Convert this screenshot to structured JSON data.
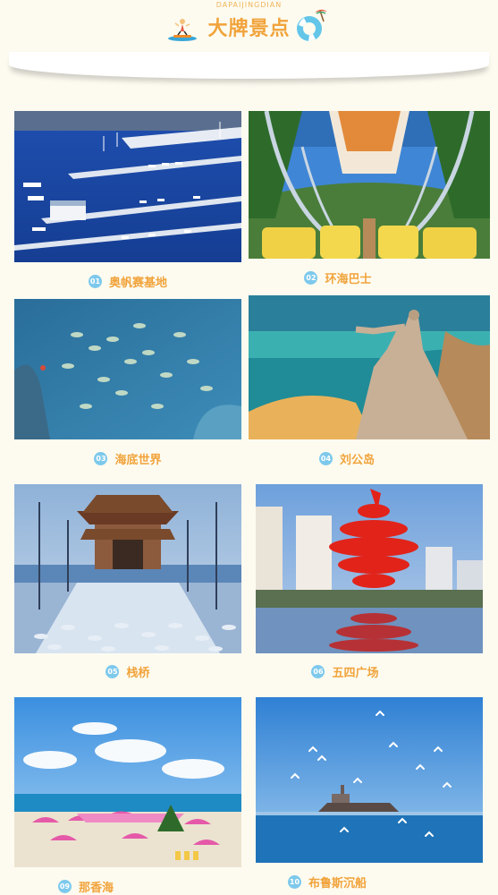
{
  "header": {
    "subtitle": "DAPAIJINGDIAN",
    "title": "大牌景点"
  },
  "spots": [
    {
      "num": "01",
      "name": "奥帆赛基地",
      "photo_icon": "marina-photo"
    },
    {
      "num": "02",
      "name": "环海巴士",
      "photo_icon": "sightseeing-bus-photo"
    },
    {
      "num": "03",
      "name": "海底世界",
      "photo_icon": "aquarium-fish-photo"
    },
    {
      "num": "04",
      "name": "刘公岛",
      "photo_icon": "statue-coast-photo"
    },
    {
      "num": "05",
      "name": "栈桥",
      "photo_icon": "pier-pavilion-photo"
    },
    {
      "num": "06",
      "name": "五四广场",
      "photo_icon": "may-fourth-sculpture-photo"
    },
    {
      "num": "09",
      "name": "那香海",
      "photo_icon": "beach-umbrellas-photo"
    },
    {
      "num": "10",
      "name": "布鲁斯沉船",
      "photo_icon": "shipwreck-seagulls-photo"
    }
  ],
  "colors": {
    "accent": "#f1a33b",
    "badge": "#7dc9ec",
    "background": "#fdfbf0"
  }
}
